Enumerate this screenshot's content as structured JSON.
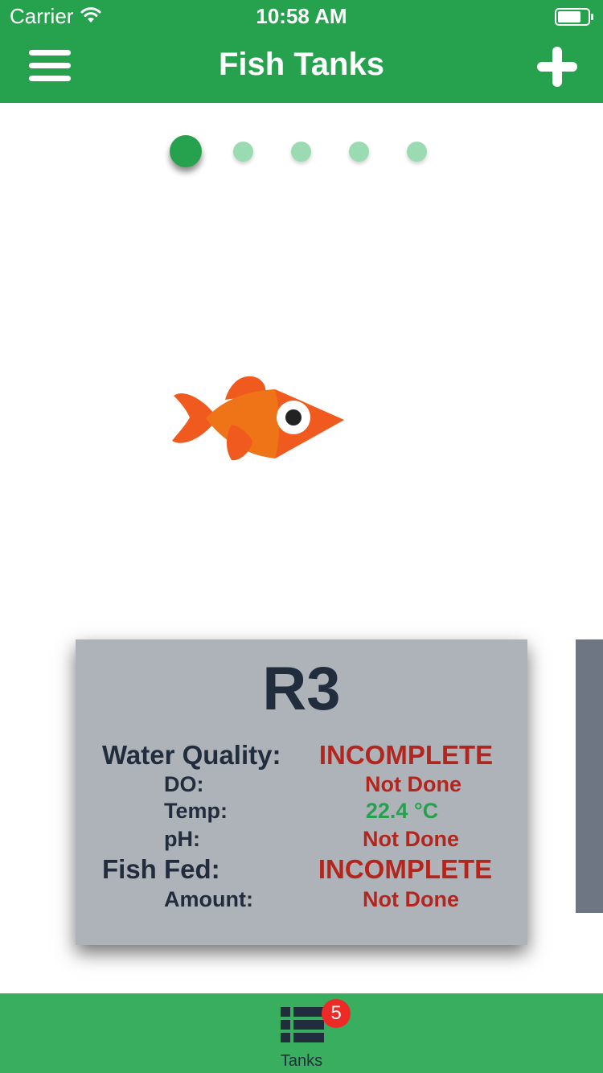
{
  "status_bar": {
    "carrier": "Carrier",
    "time": "10:58 AM"
  },
  "header": {
    "title": "Fish Tanks",
    "menu_icon": "hamburger-menu-icon",
    "add_icon": "plus-icon"
  },
  "pager": {
    "count": 5,
    "active_index": 0
  },
  "tank_card": {
    "name": "R3",
    "water_quality_label": "Water Quality:",
    "water_quality_value": "INCOMPLETE",
    "do_label": "DO:",
    "do_value": "Not Done",
    "temp_label": "Temp:",
    "temp_value": "22.4 °C",
    "ph_label": "pH:",
    "ph_value": "Not Done",
    "fish_fed_label": "Fish Fed:",
    "fish_fed_value": "INCOMPLETE",
    "amount_label": "Amount:",
    "amount_value": "Not Done"
  },
  "tab_bar": {
    "tanks_label": "Tanks",
    "tanks_badge": "5",
    "tanks_icon": "list-icon"
  },
  "colors": {
    "brand_green": "#26a24f",
    "tab_green": "#3aae5f",
    "alert_red": "#b3261e",
    "ok_green": "#26a24f",
    "card_gray": "#aeb3ba",
    "text_dark": "#212d3d",
    "fish_orange": "#f05a1f",
    "badge_red": "#ee2a27"
  }
}
